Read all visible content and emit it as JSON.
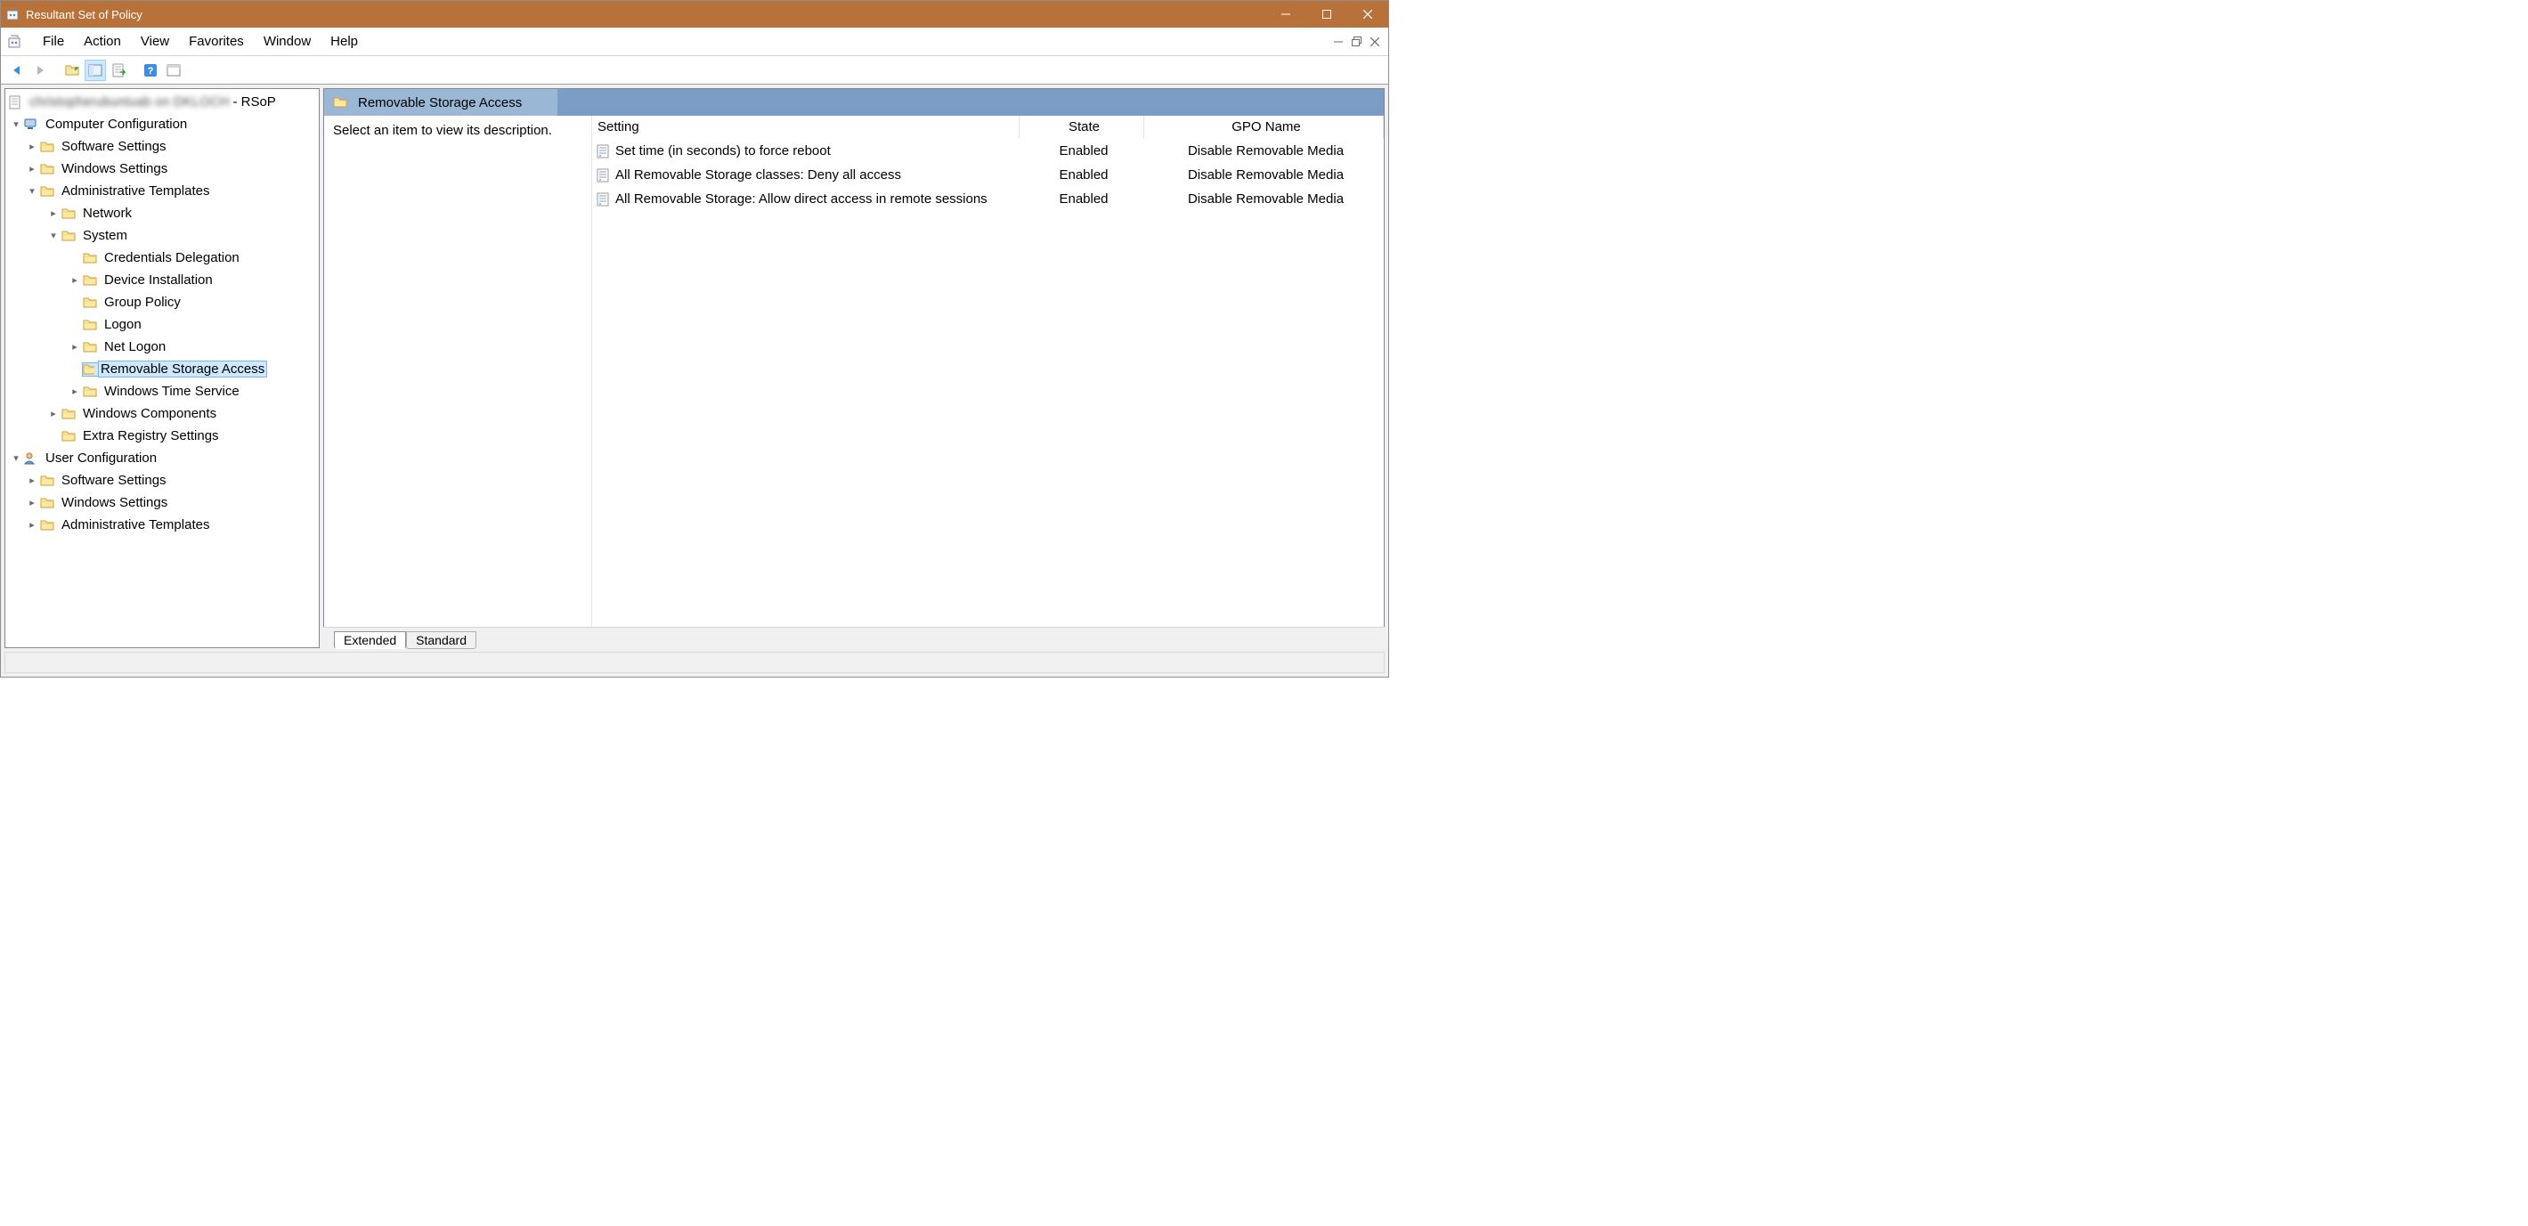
{
  "window": {
    "title": "Resultant Set of Policy"
  },
  "menus": {
    "file": "File",
    "action": "Action",
    "view": "View",
    "favorites": "Favorites",
    "window": "Window",
    "help": "Help"
  },
  "tree": {
    "root_suffix": " - RSoP",
    "computer_config": "Computer Configuration",
    "cc_software": "Software Settings",
    "cc_windows": "Windows Settings",
    "cc_admin": "Administrative Templates",
    "cc_network": "Network",
    "cc_system": "System",
    "cc_cred": "Credentials Delegation",
    "cc_devinst": "Device Installation",
    "cc_gp": "Group Policy",
    "cc_logon": "Logon",
    "cc_netlogon": "Net Logon",
    "cc_rsa": "Removable Storage Access",
    "cc_wts": "Windows Time Service",
    "cc_wincomp": "Windows Components",
    "cc_extrareg": "Extra Registry Settings",
    "user_config": "User Configuration",
    "uc_software": "Software Settings",
    "uc_windows": "Windows Settings",
    "uc_admin": "Administrative Templates"
  },
  "content": {
    "header": "Removable Storage Access",
    "desc": "Select an item to view its description.",
    "columns": {
      "setting": "Setting",
      "state": "State",
      "gpo": "GPO Name"
    },
    "rows": [
      {
        "setting": "Set time (in seconds) to force reboot",
        "state": "Enabled",
        "gpo": "Disable Removable Media"
      },
      {
        "setting": "All Removable Storage classes: Deny all access",
        "state": "Enabled",
        "gpo": "Disable Removable Media"
      },
      {
        "setting": "All Removable Storage: Allow direct access in remote sessions",
        "state": "Enabled",
        "gpo": "Disable Removable Media"
      }
    ],
    "tabs": {
      "extended": "Extended",
      "standard": "Standard"
    }
  }
}
